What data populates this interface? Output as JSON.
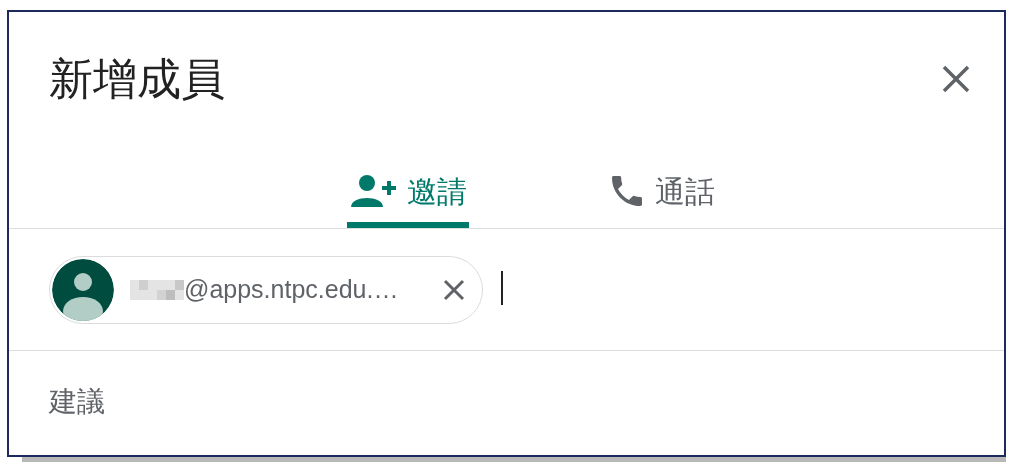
{
  "dialog": {
    "title": "新增成員"
  },
  "tabs": [
    {
      "label": "邀請",
      "kind": "invite",
      "selected": true
    },
    {
      "label": "通話",
      "kind": "call",
      "selected": false
    }
  ],
  "recipients": [
    {
      "email": "@apps.ntpc.edu.…"
    }
  ],
  "suggestions": {
    "heading": "建議"
  }
}
